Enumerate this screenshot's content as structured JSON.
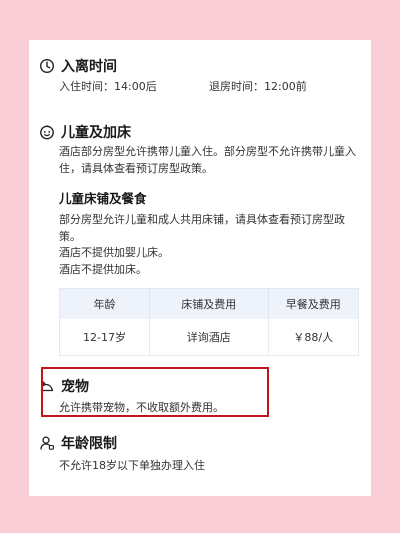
{
  "checkin": {
    "title": "入离时间",
    "checkin_label": "入住时间：",
    "checkin_value": "14:00后",
    "checkout_label": "退房时间：",
    "checkout_value": "12:00前"
  },
  "children": {
    "title": "儿童及加床",
    "line1": "酒店部分房型允许携带儿童入住。部分房型不允许携带儿童入",
    "line2": "住，请具体查看预订房型政策。",
    "sub_title": "儿童床铺及餐食",
    "sub_line1": "部分房型允许儿童和成人共用床铺，请具体查看预订房型政",
    "sub_line2": "策。",
    "sub_line3": "酒店不提供加婴儿床。",
    "sub_line4": "酒店不提供加床。",
    "table": {
      "headers": [
        "年龄",
        "床铺及费用",
        "早餐及费用"
      ],
      "rows": [
        [
          "12-17岁",
          "详询酒店",
          "￥88/人"
        ]
      ]
    }
  },
  "pets": {
    "title": "宠物",
    "text": "允许携带宠物，不收取额外费用。"
  },
  "age": {
    "title": "年龄限制",
    "text": "不允许18岁以下单独办理入住"
  },
  "colors": {
    "background": "#f9cdd6",
    "highlight_border": "#c4121e",
    "table_header": "#eef3fb"
  }
}
